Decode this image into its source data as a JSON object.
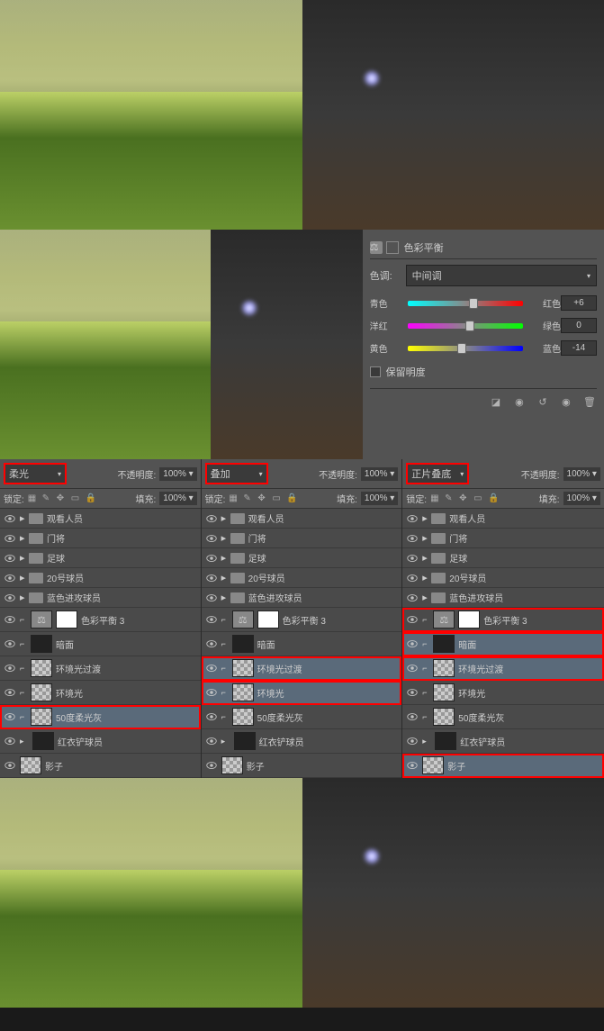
{
  "color_balance": {
    "title": "色彩平衡",
    "tone_label": "色调:",
    "tone_value": "中间调",
    "sliders": [
      {
        "left": "青色",
        "right": "红色",
        "value": "+6",
        "pos": 53
      },
      {
        "left": "洋红",
        "right": "绿色",
        "value": "0",
        "pos": 50
      },
      {
        "left": "黄色",
        "right": "蓝色",
        "value": "-14",
        "pos": 43
      }
    ],
    "preserve_lum": "保留明度"
  },
  "panels": [
    {
      "blend": "柔光",
      "opacity_label": "不透明度:",
      "opacity": "100%",
      "lock_label": "锁定:",
      "fill_label": "填充:",
      "fill": "100%",
      "layers": [
        {
          "type": "folder",
          "name": "观看人员"
        },
        {
          "type": "folder",
          "name": "门将"
        },
        {
          "type": "folder",
          "name": "足球"
        },
        {
          "type": "folder",
          "name": "20号球员"
        },
        {
          "type": "folder",
          "name": "蓝色进攻球员"
        },
        {
          "type": "adj",
          "name": "色彩平衡 3",
          "linked": true
        },
        {
          "type": "layer",
          "name": "暗面",
          "linked": true,
          "thumb": "dark"
        },
        {
          "type": "layer",
          "name": "环境光过渡",
          "linked": true,
          "thumb": "checker"
        },
        {
          "type": "layer",
          "name": "环境光",
          "linked": true,
          "thumb": "checker"
        },
        {
          "type": "layer",
          "name": "50度柔光灰",
          "linked": true,
          "thumb": "checker",
          "hl": true,
          "selected": true
        },
        {
          "type": "layer",
          "name": "红衣铲球员",
          "fx": true,
          "thumb": "dark"
        },
        {
          "type": "layer",
          "name": "影子",
          "thumb": "checker"
        }
      ]
    },
    {
      "blend": "叠加",
      "opacity_label": "不透明度:",
      "opacity": "100%",
      "lock_label": "锁定:",
      "fill_label": "填充:",
      "fill": "100%",
      "layers": [
        {
          "type": "folder",
          "name": "观看人员"
        },
        {
          "type": "folder",
          "name": "门将"
        },
        {
          "type": "folder",
          "name": "足球"
        },
        {
          "type": "folder",
          "name": "20号球员"
        },
        {
          "type": "folder",
          "name": "蓝色进攻球员"
        },
        {
          "type": "adj",
          "name": "色彩平衡 3",
          "linked": true
        },
        {
          "type": "layer",
          "name": "暗面",
          "linked": true,
          "thumb": "dark"
        },
        {
          "type": "layer",
          "name": "环境光过渡",
          "linked": true,
          "thumb": "checker",
          "hl": true,
          "selected": true
        },
        {
          "type": "layer",
          "name": "环境光",
          "linked": true,
          "thumb": "checker",
          "hl": true,
          "selected": true
        },
        {
          "type": "layer",
          "name": "50度柔光灰",
          "linked": true,
          "thumb": "checker"
        },
        {
          "type": "layer",
          "name": "红衣铲球员",
          "fx": true,
          "thumb": "dark"
        },
        {
          "type": "layer",
          "name": "影子",
          "thumb": "checker"
        }
      ]
    },
    {
      "blend": "正片叠底",
      "opacity_label": "不透明度:",
      "opacity": "100%",
      "lock_label": "锁定:",
      "fill_label": "填充:",
      "fill": "100%",
      "layers": [
        {
          "type": "folder",
          "name": "观看人员"
        },
        {
          "type": "folder",
          "name": "门将"
        },
        {
          "type": "folder",
          "name": "足球"
        },
        {
          "type": "folder",
          "name": "20号球员"
        },
        {
          "type": "folder",
          "name": "蓝色进攻球员"
        },
        {
          "type": "adj",
          "name": "色彩平衡 3",
          "linked": true,
          "hl": true
        },
        {
          "type": "layer",
          "name": "暗面",
          "linked": true,
          "thumb": "dark",
          "hl": true,
          "selected": true
        },
        {
          "type": "layer",
          "name": "环境光过渡",
          "linked": true,
          "thumb": "checker",
          "hl": true,
          "selected": true
        },
        {
          "type": "layer",
          "name": "环境光",
          "linked": true,
          "thumb": "checker"
        },
        {
          "type": "layer",
          "name": "50度柔光灰",
          "linked": true,
          "thumb": "checker"
        },
        {
          "type": "layer",
          "name": "红衣铲球员",
          "fx": true,
          "thumb": "dark"
        },
        {
          "type": "layer",
          "name": "影子",
          "thumb": "checker",
          "hl": true,
          "selected": true
        }
      ]
    }
  ]
}
